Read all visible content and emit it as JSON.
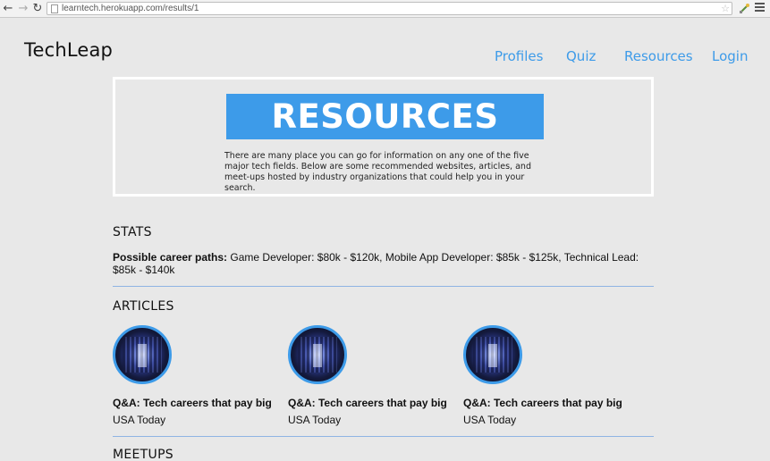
{
  "browser": {
    "url": "learntech.herokuapp.com/results/1",
    "back_glyph": "←",
    "forward_glyph": "→",
    "reload_glyph": "↻",
    "star_glyph": "☆"
  },
  "header": {
    "logo": "TechLeap",
    "nav": [
      {
        "label": "Profiles"
      },
      {
        "label": "Quiz"
      },
      {
        "label": "Resources"
      },
      {
        "label": "Login"
      }
    ]
  },
  "hero": {
    "banner": "RESOURCES",
    "intro": "There are many place you can go for information on any one of the five major tech fields. Below are some recommended websites, articles, and meet-ups hosted by industry organizations that could help you in your search."
  },
  "stats": {
    "title": "STATS",
    "label": "Possible career paths:",
    "text": " Game Developer: $80k - $120k, Mobile App Developer: $85k - $125k, Technical Lead: $85k - $140k"
  },
  "articles": {
    "title": "ARTICLES",
    "items": [
      {
        "title": "Q&A: Tech careers that pay big",
        "source": "USA Today"
      },
      {
        "title": "Q&A: Tech careers that pay big",
        "source": "USA Today"
      },
      {
        "title": "Q&A: Tech careers that pay big",
        "source": "USA Today"
      }
    ]
  },
  "meetups": {
    "title": "MEETUPS"
  },
  "colors": {
    "accent": "#3d9be9",
    "background": "#e8e8e8",
    "divider": "#8fb4e3"
  }
}
